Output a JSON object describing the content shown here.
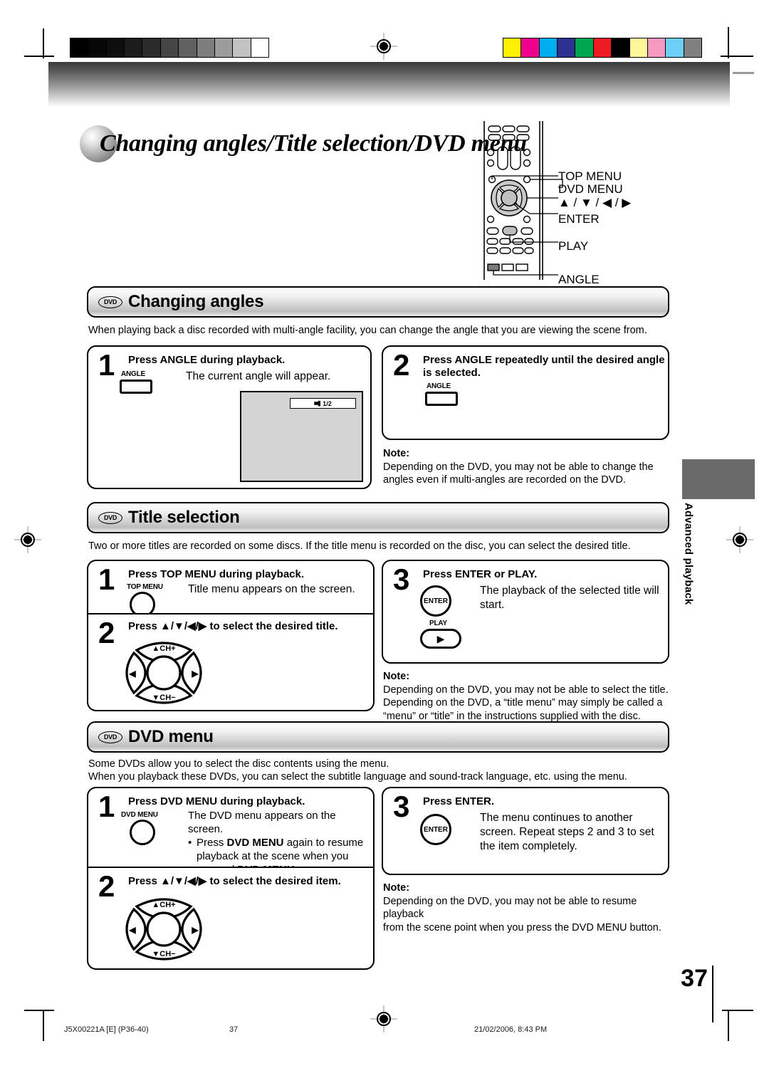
{
  "page": {
    "title": "Changing angles/Title selection/DVD menu",
    "number": "37",
    "side_tab": "Advanced playback"
  },
  "remote": {
    "callouts": [
      "TOP MENU",
      "DVD MENU",
      "▲ / ▼ / ◀ / ▶",
      "ENTER",
      "PLAY",
      "ANGLE"
    ]
  },
  "sections": [
    {
      "badge": "DVD",
      "title": "Changing angles",
      "intro": "When playing back a disc recorded with multi-angle facility, you can change the angle that you are viewing the scene from.",
      "steps": [
        {
          "num": "1",
          "head": "Press ANGLE during playback.",
          "button_label": "ANGLE",
          "body": "The current angle will appear.",
          "screen_chip": "1/2"
        },
        {
          "num": "2",
          "head": "Press ANGLE repeatedly until the desired angle is selected.",
          "button_label": "ANGLE"
        }
      ],
      "note": {
        "title": "Note:",
        "lines": [
          "Depending on the DVD, you may not be able to change the",
          "angles even if multi-angles are recorded on the DVD."
        ]
      }
    },
    {
      "badge": "DVD",
      "title": "Title selection",
      "intro": "Two or more titles are recorded on some discs. If the title menu is recorded on the disc, you can select the desired title.",
      "steps": [
        {
          "num": "1",
          "head": "Press TOP MENU during playback.",
          "button_label": "TOP MENU",
          "body": "Title menu appears on the screen."
        },
        {
          "num": "2",
          "head": "Press ▲/▼/◀/▶ to select the desired title.",
          "pad": {
            "up": "▲CH+",
            "down": "▼CH−",
            "left": "◀",
            "right": "▶"
          }
        },
        {
          "num": "3",
          "head": "Press ENTER or PLAY.",
          "button_label": "ENTER",
          "button_label2": "PLAY",
          "body_lines": [
            "The playback of the selected title will",
            "start."
          ]
        }
      ],
      "note": {
        "title": "Note:",
        "lines": [
          "Depending on the DVD, you may not be able to select the title.",
          "Depending on the DVD, a “title menu” may simply be called a",
          "“menu” or “title” in the instructions supplied with the disc."
        ]
      }
    },
    {
      "badge": "DVD",
      "title": "DVD menu",
      "intro_lines": [
        "Some DVDs allow you to select the disc contents using the menu.",
        "When you playback these DVDs, you can select the subtitle language and sound-track language, etc. using the menu."
      ],
      "steps": [
        {
          "num": "1",
          "head": "Press DVD MENU during playback.",
          "button_label": "DVD MENU",
          "body": "The DVD menu appears on the screen.",
          "bullet_parts": [
            {
              "t": "Press ",
              "b": false
            },
            {
              "t": "DVD MENU",
              "b": true
            },
            {
              "t": " again to resume",
              "b": false
            }
          ],
          "bullet_line2": "playback at the scene when you",
          "bullet_line3_parts": [
            {
              "t": "pressed ",
              "b": false
            },
            {
              "t": "DVD MENU",
              "b": true
            },
            {
              "t": ".",
              "b": false
            }
          ]
        },
        {
          "num": "2",
          "head": "Press ▲/▼/◀/▶ to select the desired item.",
          "pad": {
            "up": "▲CH+",
            "down": "▼CH−",
            "left": "◀",
            "right": "▶"
          }
        },
        {
          "num": "3",
          "head": "Press ENTER.",
          "button_label": "ENTER",
          "body_lines": [
            "The menu continues to another",
            "screen. Repeat steps 2 and 3 to set",
            "the item completely."
          ]
        }
      ],
      "note": {
        "title": "Note:",
        "lines": [
          "Depending on the DVD, you may not be able to resume playback",
          "from the scene point when you press the DVD MENU button."
        ]
      }
    }
  ],
  "footer": {
    "doc_id": "J5X00221A [E] (P36-40)",
    "page": "37",
    "timestamp": "21/02/2006, 8:43 PM"
  },
  "calibration": {
    "gray_swatches": [
      "#000000",
      "#070707",
      "#0e0e0e",
      "#1c1c1c",
      "#2b2b2b",
      "#454545",
      "#616161",
      "#7d7d7d",
      "#9c9c9c",
      "#c2c2c2",
      "#ffffff"
    ],
    "color_swatches": [
      "#fff200",
      "#ec008c",
      "#00aeef",
      "#2e3192",
      "#00a651",
      "#ed1c24",
      "#000000",
      "#fff799",
      "#f49ac1",
      "#6dcff6",
      "#808080"
    ]
  }
}
